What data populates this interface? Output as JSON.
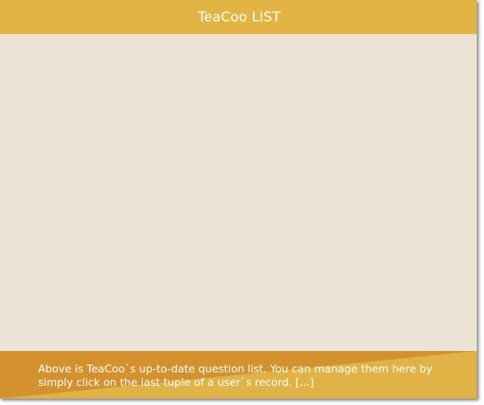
{
  "header": {
    "title": "TeaCoo LIST"
  },
  "footer": {
    "description": "Above is TeaCoo`s up-to-date question list. You can manage them here by simply click on the last tuple of a user`s record. [...]"
  },
  "colors": {
    "header_bg": "#e2b444",
    "content_bg": "#ebe4d6",
    "footer_dark": "#d3922e",
    "footer_light": "#e0b346"
  }
}
